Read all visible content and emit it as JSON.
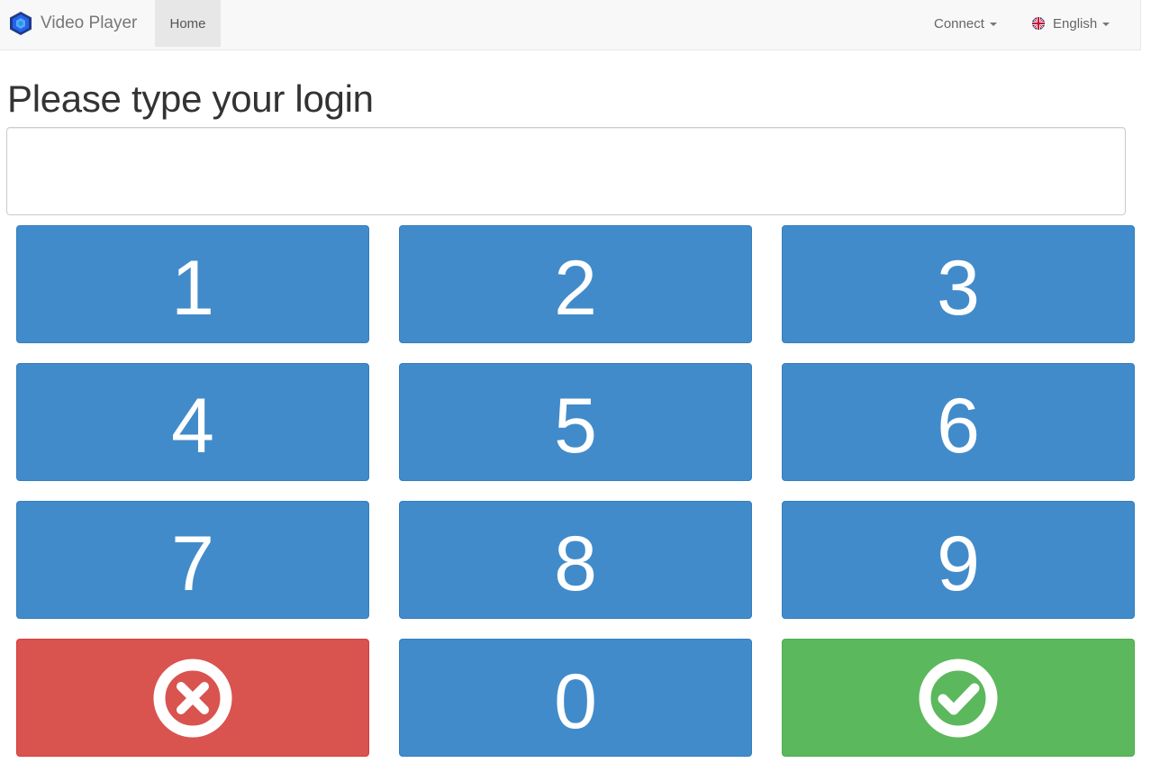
{
  "navbar": {
    "brand": "Video Player",
    "home": "Home",
    "connect": "Connect",
    "language": "English"
  },
  "page": {
    "title": "Please type your login"
  },
  "login_input": {
    "value": "",
    "placeholder": ""
  },
  "keypad": {
    "keys": [
      "1",
      "2",
      "3",
      "4",
      "5",
      "6",
      "7",
      "8",
      "9",
      "0"
    ],
    "cancel_icon": "times-circle-icon",
    "confirm_icon": "check-circle-icon"
  },
  "colors": {
    "primary": "#428bca",
    "danger": "#d9534f",
    "success": "#5cb85c",
    "navbar_bg": "#f8f8f8"
  }
}
